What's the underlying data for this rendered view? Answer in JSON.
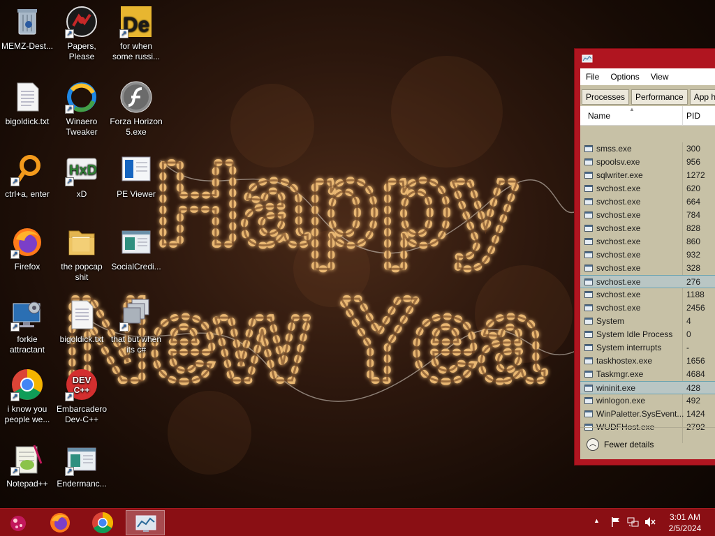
{
  "wallpaper": {
    "line1": "Happy",
    "line2": "New Yea"
  },
  "desktop": {
    "icons": [
      {
        "label": "MEMZ-Dest...",
        "icon": "recycle-bin-icon"
      },
      {
        "label": "Papers, Please",
        "icon": "papers-please-icon"
      },
      {
        "label": "for when some russi...",
        "icon": "de-app-icon"
      },
      {
        "label": "bigoldick.txt",
        "icon": "text-file-icon"
      },
      {
        "label": "Winaero Tweaker",
        "icon": "winaero-icon"
      },
      {
        "label": "Forza Horizon 5.exe",
        "icon": "flash-icon"
      },
      {
        "label": "ctrl+a, enter",
        "icon": "orange-ring-icon"
      },
      {
        "label": "xD",
        "icon": "hxd-icon"
      },
      {
        "label": "PE Viewer",
        "icon": "pe-viewer-icon"
      },
      {
        "label": "Firefox",
        "icon": "firefox-icon"
      },
      {
        "label": "the popcap shit",
        "icon": "folder-icon"
      },
      {
        "label": "SocialCredi...",
        "icon": "app-window-icon"
      },
      {
        "label": "forkie attractant",
        "icon": "monitor-gear-icon"
      },
      {
        "label": "bigoldick.txt",
        "icon": "text-file-icon"
      },
      {
        "label": "that but when its c#",
        "icon": "stacked-windows-icon"
      },
      {
        "label": "i know you people we...",
        "icon": "chrome-icon"
      },
      {
        "label": "Embarcadero Dev-C++",
        "icon": "devcpp-icon"
      },
      {
        "label": "Notepad++",
        "icon": "notepadpp-icon"
      },
      {
        "label": "Endermanc...",
        "icon": "app-window-icon"
      }
    ],
    "devcpp_badge": "DEV",
    "devcpp_sub": "C++",
    "hxd_text": "HxD",
    "de_text": "De"
  },
  "task_manager": {
    "menu": [
      "File",
      "Options",
      "View"
    ],
    "tabs": [
      "Processes",
      "Performance",
      "App hist"
    ],
    "columns": {
      "name": "Name",
      "pid": "PID"
    },
    "rows": [
      {
        "name": "smss.exe",
        "pid": "300"
      },
      {
        "name": "spoolsv.exe",
        "pid": "956"
      },
      {
        "name": "sqlwriter.exe",
        "pid": "1272"
      },
      {
        "name": "svchost.exe",
        "pid": "620"
      },
      {
        "name": "svchost.exe",
        "pid": "664"
      },
      {
        "name": "svchost.exe",
        "pid": "784"
      },
      {
        "name": "svchost.exe",
        "pid": "828"
      },
      {
        "name": "svchost.exe",
        "pid": "860"
      },
      {
        "name": "svchost.exe",
        "pid": "932"
      },
      {
        "name": "svchost.exe",
        "pid": "328"
      },
      {
        "name": "svchost.exe",
        "pid": "276"
      },
      {
        "name": "svchost.exe",
        "pid": "1188"
      },
      {
        "name": "svchost.exe",
        "pid": "2456"
      },
      {
        "name": "System",
        "pid": "4"
      },
      {
        "name": "System Idle Process",
        "pid": "0"
      },
      {
        "name": "System interrupts",
        "pid": "-"
      },
      {
        "name": "taskhostex.exe",
        "pid": "1656"
      },
      {
        "name": "Taskmgr.exe",
        "pid": "4684"
      },
      {
        "name": "wininit.exe",
        "pid": "428"
      },
      {
        "name": "winlogon.exe",
        "pid": "492"
      },
      {
        "name": "WinPaletter.SysEvent...",
        "pid": "1424"
      },
      {
        "name": "WUDFHost.exe",
        "pid": "2792"
      }
    ],
    "selected_rows": [
      10,
      18
    ],
    "footer": "Fewer details"
  },
  "taskbar": {
    "pinned": [
      "start-orb-icon",
      "firefox-icon",
      "chrome-icon",
      "task-manager-icon"
    ],
    "clock_time": "3:01 AM",
    "clock_date": "2/5/2024"
  },
  "colors": {
    "taskbar": "#8a0f14",
    "window_frame": "#b01520",
    "window_body": "#c7c1a6",
    "selection": "#b9c6c4"
  }
}
